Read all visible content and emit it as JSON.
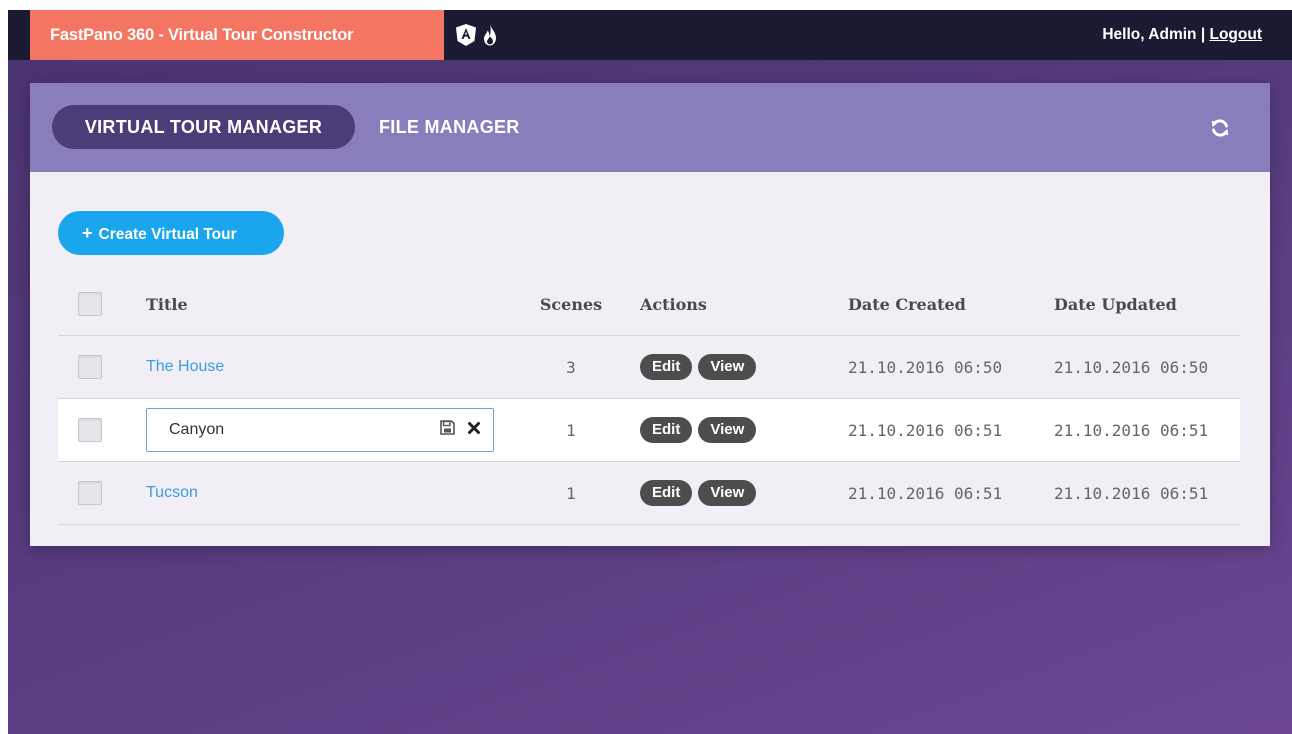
{
  "topbar": {
    "brand": "FastPano 360 - Virtual Tour Constructor",
    "tech_icons": [
      "angular-icon",
      "firebase-icon"
    ],
    "greeting": "Hello, Admin",
    "separator": "|",
    "logout": "Logout"
  },
  "tabs": {
    "active": "VIRTUAL TOUR MANAGER",
    "other": "FILE MANAGER"
  },
  "header_icons": {
    "refresh": "refresh-icon"
  },
  "create_button": {
    "icon": "+",
    "label": "Create Virtual Tour"
  },
  "table": {
    "columns": [
      "Title",
      "Scenes",
      "Actions",
      "Date Created",
      "Date Updated"
    ],
    "rows": [
      {
        "title": "The House",
        "scenes": "3",
        "actions": [
          "Edit",
          "View"
        ],
        "created": "21.10.2016 06:50",
        "updated": "21.10.2016 06:50",
        "editing": false
      },
      {
        "title": "Canyon",
        "scenes": "1",
        "actions": [
          "Edit",
          "View"
        ],
        "created": "21.10.2016 06:51",
        "updated": "21.10.2016 06:51",
        "editing": true
      },
      {
        "title": "Tucson",
        "scenes": "1",
        "actions": [
          "Edit",
          "View"
        ],
        "created": "21.10.2016 06:51",
        "updated": "21.10.2016 06:51",
        "editing": false
      }
    ]
  },
  "edit_icons": [
    "save-icon",
    "close-icon"
  ],
  "colors": {
    "topbar_bg": "#1a1b33",
    "brand_bg": "#f47562",
    "card_header_bg": "#8a7dbb",
    "active_tab_bg": "#4c3d78",
    "create_button_bg": "#1aa6ec",
    "link": "#3a9fe0",
    "pill_bg": "#4d4d4d"
  }
}
